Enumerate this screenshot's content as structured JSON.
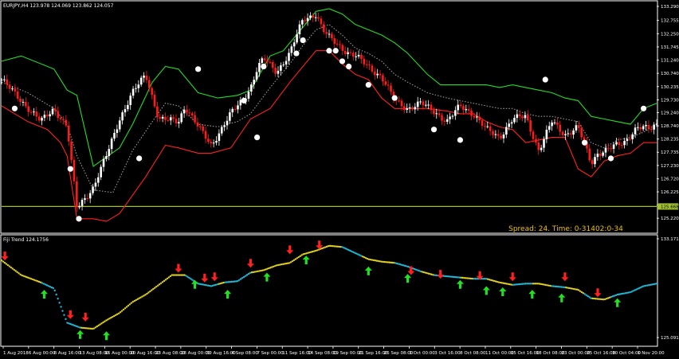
{
  "window": {
    "main_header": "EURJPY,H4  123.978 124.069 123.862 124.057",
    "sub_header": "Fiji Trend 124.1756",
    "status_text": "Spread: 24. Time: 0-31402:0-34"
  },
  "colors": {
    "background": "#000000",
    "frame": "#ffffff",
    "bull_candle": "#ffffff",
    "bear_candle": "#ff1a1a",
    "upper_band": "#22dd22",
    "lower_band": "#ff2020",
    "mid_band": "#9a9a9a",
    "marker": "#ffffff",
    "hline": "#a0c030",
    "trend_up": "#20b8d8",
    "trend_down": "#e0d020",
    "arrow_up": "#22e022",
    "arrow_down": "#ff2020",
    "status": "#f0c000"
  },
  "chart_data": [
    {
      "type": "candlestick",
      "symbol": "EURJPY",
      "timeframe": "H4",
      "ohlc_last": {
        "open": 123.978,
        "high": 124.069,
        "low": 123.862,
        "close": 124.057
      },
      "ylim": [
        124.71,
        133.29
      ],
      "y_ticks": [
        "133.290",
        "132.755",
        "132.250",
        "131.745",
        "131.240",
        "130.740",
        "130.235",
        "129.730",
        "129.240",
        "128.740",
        "128.235",
        "127.735",
        "127.230",
        "126.720",
        "126.225",
        "125.720",
        "125.220"
      ],
      "current_price_label": "125.668",
      "hline_price": 125.668,
      "series": [
        {
          "name": "close",
          "x": [
            0,
            0.03,
            0.06,
            0.08,
            0.1,
            0.115,
            0.14,
            0.16,
            0.18,
            0.2,
            0.22,
            0.24,
            0.27,
            0.28,
            0.3,
            0.32,
            0.35,
            0.37,
            0.38,
            0.39,
            0.4,
            0.42,
            0.44,
            0.46,
            0.48,
            0.49,
            0.5,
            0.52,
            0.53,
            0.54,
            0.55,
            0.56,
            0.58,
            0.6,
            0.62,
            0.64,
            0.66,
            0.68,
            0.7,
            0.72,
            0.74,
            0.76,
            0.78,
            0.8,
            0.82,
            0.84,
            0.86,
            0.88,
            0.9,
            0.91,
            0.93,
            0.95,
            0.97,
            0.99,
            1.0
          ],
          "values": [
            130.5,
            129.7,
            128.9,
            129.4,
            128.7,
            125.6,
            126.4,
            127.6,
            129.0,
            130.0,
            130.7,
            129.0,
            128.9,
            129.5,
            128.7,
            128.0,
            129.2,
            129.8,
            130.2,
            130.9,
            131.3,
            130.8,
            131.5,
            132.8,
            133.0,
            132.4,
            132.1,
            131.7,
            131.5,
            131.4,
            131.2,
            131.0,
            130.6,
            129.7,
            129.4,
            129.6,
            129.3,
            128.9,
            129.5,
            129.2,
            128.6,
            128.3,
            129.0,
            129.1,
            127.8,
            128.9,
            128.4,
            128.7,
            127.3,
            127.7,
            127.9,
            128.1,
            128.7,
            128.6,
            128.8
          ]
        },
        {
          "name": "upper_band",
          "x": [
            0,
            0.03,
            0.08,
            0.1,
            0.115,
            0.14,
            0.18,
            0.2,
            0.23,
            0.25,
            0.27,
            0.3,
            0.33,
            0.36,
            0.38,
            0.41,
            0.43,
            0.46,
            0.48,
            0.5,
            0.52,
            0.54,
            0.56,
            0.58,
            0.6,
            0.62,
            0.65,
            0.67,
            0.7,
            0.72,
            0.74,
            0.76,
            0.78,
            0.8,
            0.82,
            0.84,
            0.86,
            0.88,
            0.9,
            0.92,
            0.94,
            0.96,
            0.98,
            1.0
          ],
          "values": [
            131.2,
            131.4,
            130.9,
            130.1,
            129.9,
            127.2,
            127.9,
            128.8,
            130.4,
            131.0,
            130.9,
            130.0,
            129.8,
            129.9,
            130.1,
            131.4,
            131.6,
            132.5,
            133.1,
            133.2,
            133.0,
            132.6,
            132.4,
            132.2,
            131.9,
            131.5,
            130.7,
            130.3,
            130.3,
            130.3,
            130.3,
            130.2,
            130.3,
            130.2,
            130.1,
            130.0,
            129.8,
            129.7,
            129.1,
            129.0,
            128.9,
            128.8,
            129.4,
            129.6
          ]
        },
        {
          "name": "lower_band",
          "x": [
            0,
            0.04,
            0.07,
            0.09,
            0.1,
            0.115,
            0.14,
            0.16,
            0.18,
            0.22,
            0.25,
            0.27,
            0.3,
            0.32,
            0.35,
            0.38,
            0.41,
            0.44,
            0.46,
            0.48,
            0.5,
            0.52,
            0.54,
            0.56,
            0.58,
            0.6,
            0.62,
            0.65,
            0.68,
            0.7,
            0.72,
            0.74,
            0.76,
            0.78,
            0.8,
            0.82,
            0.84,
            0.86,
            0.88,
            0.9,
            0.92,
            0.94,
            0.96,
            0.98,
            1.0
          ],
          "values": [
            129.5,
            128.9,
            128.6,
            128.1,
            127.6,
            125.2,
            125.2,
            125.1,
            125.4,
            126.8,
            128.0,
            127.9,
            127.7,
            127.7,
            127.9,
            129.0,
            129.4,
            130.4,
            131.0,
            131.6,
            131.6,
            131.1,
            130.7,
            130.5,
            129.8,
            129.4,
            129.4,
            129.4,
            129.3,
            129.2,
            129.2,
            128.9,
            128.7,
            128.6,
            128.1,
            128.2,
            128.3,
            128.3,
            127.1,
            126.8,
            127.4,
            127.6,
            127.7,
            128.1,
            128.1
          ]
        },
        {
          "name": "mid_band",
          "x": [
            0,
            0.04,
            0.08,
            0.1,
            0.115,
            0.14,
            0.17,
            0.2,
            0.23,
            0.25,
            0.27,
            0.3,
            0.33,
            0.36,
            0.38,
            0.41,
            0.44,
            0.46,
            0.48,
            0.5,
            0.52,
            0.54,
            0.56,
            0.58,
            0.6,
            0.62,
            0.65,
            0.68,
            0.7,
            0.72,
            0.74,
            0.76,
            0.78,
            0.8,
            0.82,
            0.84,
            0.86,
            0.88,
            0.9,
            0.92,
            0.94,
            0.96,
            0.98,
            1.0
          ],
          "values": [
            130.4,
            130.0,
            129.4,
            128.8,
            127.6,
            126.3,
            126.2,
            127.8,
            128.9,
            129.6,
            129.5,
            128.8,
            128.7,
            128.9,
            129.2,
            130.2,
            131.1,
            131.8,
            132.4,
            132.6,
            132.2,
            131.7,
            131.5,
            131.2,
            130.7,
            130.4,
            130.0,
            129.8,
            129.7,
            129.6,
            129.5,
            129.4,
            129.4,
            129.2,
            129.1,
            129.1,
            129.0,
            128.9,
            128.1,
            127.9,
            128.2,
            128.3,
            128.5,
            128.8
          ]
        },
        {
          "name": "markers",
          "x": [
            0.02,
            0.105,
            0.118,
            0.21,
            0.3,
            0.37,
            0.39,
            0.4,
            0.45,
            0.46,
            0.5,
            0.51,
            0.52,
            0.53,
            0.56,
            0.6,
            0.66,
            0.7,
            0.83,
            0.89,
            0.93,
            0.98
          ],
          "values": [
            129.4,
            127.1,
            125.2,
            127.5,
            130.9,
            129.7,
            128.3,
            131.0,
            131.5,
            132.0,
            131.6,
            131.6,
            131.2,
            131.0,
            130.3,
            129.8,
            128.6,
            128.2,
            130.5,
            128.1,
            127.5,
            129.4
          ]
        }
      ]
    },
    {
      "type": "line",
      "name": "Fiji Trend",
      "current_value": 124.1756,
      "ylim": [
        125.0919,
        133.1715
      ],
      "y_ticks": [
        "133.1715",
        "125.0919"
      ],
      "x_ticks": [
        "1 Aug 2018",
        "6 Aug 00:00",
        "8 Aug 16:00",
        "13 Aug 08:00",
        "16 Aug 00:00",
        "20 Aug 16:00",
        "23 Aug 08:00",
        "28 Aug 00:00",
        "30 Aug 16:00",
        "4 Sep 08:00",
        "7 Sep 00:00",
        "11 Sep 16:00",
        "14 Sep 08:00",
        "19 Sep 00:00",
        "21 Sep 16:00",
        "26 Sep 08:00",
        "1 Oct 00:00",
        "3 Oct 16:00",
        "8 Oct 08:00",
        "11 Oct 00:00",
        "15 Oct 16:00",
        "18 Oct 08:00",
        "23 Oct 00:00",
        "25 Oct 16:00",
        "30 Oct 04:00",
        "1 Nov 20:00"
      ],
      "series": [
        {
          "name": "trend",
          "x": [
            0,
            0.03,
            0.06,
            0.08,
            0.1,
            0.12,
            0.14,
            0.16,
            0.18,
            0.2,
            0.22,
            0.24,
            0.26,
            0.28,
            0.3,
            0.32,
            0.34,
            0.36,
            0.38,
            0.4,
            0.42,
            0.44,
            0.46,
            0.48,
            0.5,
            0.52,
            0.54,
            0.56,
            0.58,
            0.6,
            0.62,
            0.64,
            0.66,
            0.68,
            0.7,
            0.72,
            0.74,
            0.76,
            0.78,
            0.8,
            0.82,
            0.84,
            0.86,
            0.88,
            0.9,
            0.92,
            0.94,
            0.96,
            0.98,
            1.0
          ],
          "values": [
            131.4,
            130.2,
            129.6,
            129.1,
            126.3,
            125.9,
            125.8,
            126.5,
            127.1,
            128.0,
            128.6,
            129.4,
            130.2,
            130.2,
            129.5,
            129.3,
            129.6,
            129.7,
            130.4,
            130.6,
            131.0,
            131.2,
            131.9,
            132.2,
            132.6,
            132.5,
            132.0,
            131.5,
            131.3,
            131.2,
            130.9,
            130.5,
            130.2,
            130.1,
            130.0,
            129.9,
            129.9,
            129.6,
            129.4,
            129.5,
            129.5,
            129.3,
            129.2,
            129.0,
            128.3,
            128.2,
            128.6,
            128.8,
            129.3,
            129.5
          ]
        },
        {
          "name": "trend_direction",
          "x": [
            0,
            0.06,
            0.12,
            0.28,
            0.33,
            0.34,
            0.38,
            0.52,
            0.55,
            0.6,
            0.64,
            0.66,
            0.7,
            0.72,
            0.74,
            0.78,
            0.81,
            0.84,
            0.86,
            0.89,
            0.9,
            0.93,
            0.97
          ],
          "values": [
            "down",
            "up",
            "down",
            "up",
            "down",
            "up",
            "down",
            "up",
            "down",
            "up",
            "down",
            "up",
            "down",
            "up",
            "down",
            "up",
            "down",
            "up",
            "down",
            "up",
            "down",
            "up",
            "up"
          ]
        },
        {
          "name": "arrows_up",
          "x": [
            0.065,
            0.12,
            0.16,
            0.295,
            0.345,
            0.405,
            0.465,
            0.56,
            0.62,
            0.7,
            0.74,
            0.765,
            0.81,
            0.855,
            0.94
          ],
          "values": [
            128.8,
            125.5,
            125.4,
            129.6,
            128.8,
            130.2,
            131.6,
            130.7,
            130.1,
            129.6,
            129.1,
            129.0,
            128.8,
            128.5,
            128.1
          ]
        },
        {
          "name": "arrows_down",
          "x": [
            0.005,
            0.105,
            0.128,
            0.27,
            0.31,
            0.325,
            0.38,
            0.44,
            0.485,
            0.625,
            0.67,
            0.73,
            0.78,
            0.86,
            0.91
          ],
          "values": [
            131.6,
            126.8,
            126.6,
            130.6,
            129.8,
            129.9,
            131.0,
            132.1,
            132.5,
            130.4,
            130.1,
            130.0,
            129.9,
            129.9,
            128.6
          ]
        }
      ]
    }
  ]
}
